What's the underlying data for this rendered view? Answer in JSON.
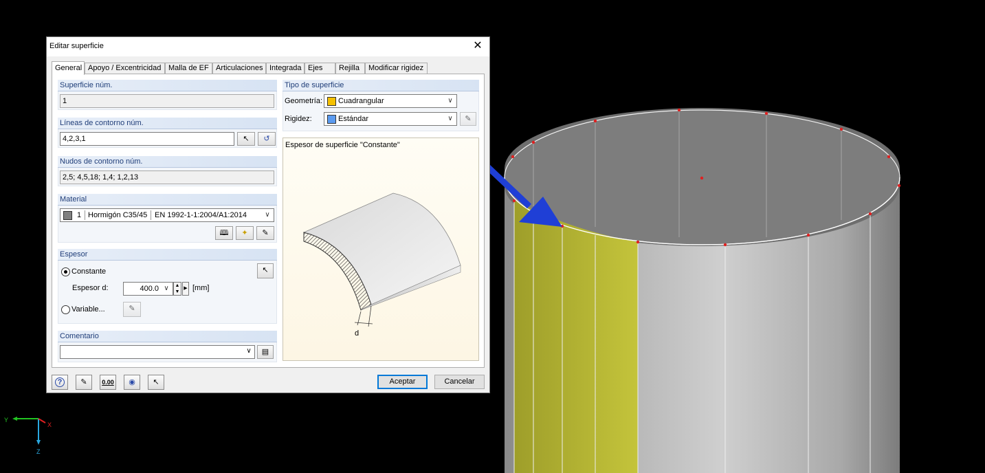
{
  "dialog": {
    "title": "Editar superficie",
    "close_glyph": "✕",
    "tabs": [
      "General",
      "Apoyo / Excentricidad",
      "Malla de EF",
      "Articulaciones",
      "Integrada",
      "Ejes",
      "Rejilla",
      "Modificar rigidez"
    ],
    "active_tab": "General",
    "surface_number": {
      "label": "Superficie núm.",
      "value": "1"
    },
    "boundary_lines": {
      "label": "Líneas de contorno núm.",
      "value": "4,2,3,1"
    },
    "boundary_nodes": {
      "label": "Nudos de contorno núm.",
      "value": "2,5; 4,5,18; 1,4; 1,2,13"
    },
    "material": {
      "label": "Material",
      "number": "1",
      "name": "Hormigón C35/45",
      "standard": "EN 1992-1-1:2004/A1:2014",
      "swatch_color": "#808080"
    },
    "thickness": {
      "label": "Espesor",
      "constant_label": "Constante",
      "thickness_label": "Espesor d:",
      "value": "400.0",
      "unit": "[mm]",
      "variable_label": "Variable...",
      "selected": "Constante"
    },
    "comment": {
      "label": "Comentario",
      "value": ""
    },
    "surface_type": {
      "label": "Tipo de superficie",
      "geometry_label": "Geometría:",
      "geometry_value": "Cuadrangular",
      "geometry_color": "#f5c000",
      "stiffness_label": "Rigidez:",
      "stiffness_value": "Estándar",
      "stiffness_color": "#5b9bf0"
    },
    "preview": {
      "title": "Espesor de superficie \"Constante\"",
      "dim_label": "d"
    },
    "buttons": {
      "ok": "Aceptar",
      "cancel": "Cancelar"
    },
    "footer_icons": [
      "help-icon",
      "edit-icon",
      "units-icon",
      "view-icon",
      "pick-icon"
    ],
    "units_icon_text": "0.00"
  },
  "axes": {
    "y": "Y",
    "x": "X",
    "z": "Z"
  },
  "colors": {
    "highlight_surface": "#bcbc35",
    "arrow": "#1f3fd6",
    "node": "#e02020"
  }
}
